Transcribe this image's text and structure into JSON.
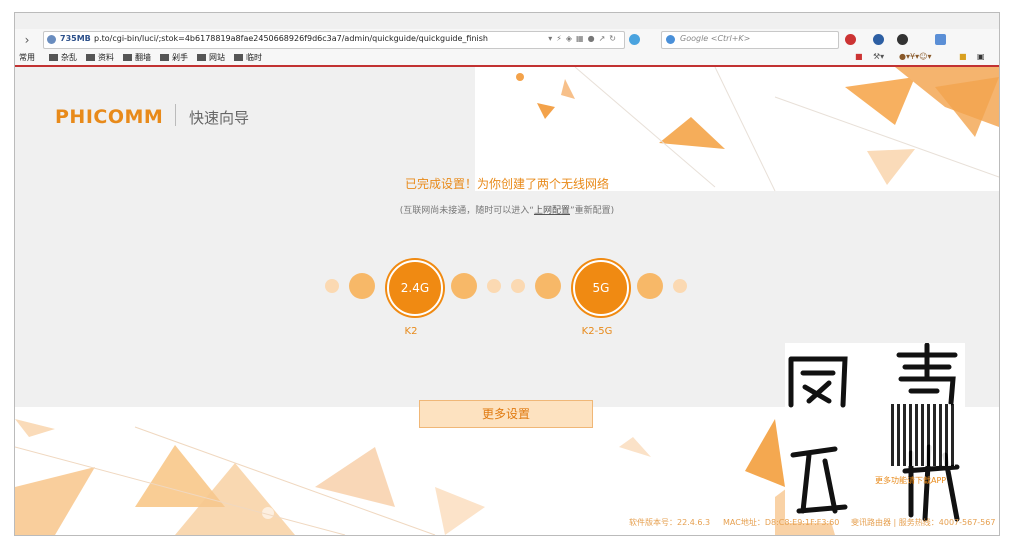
{
  "browser": {
    "memory": "735MB",
    "url": "p.to/cgi-bin/luci/;stok=4b6178819a8fae2450668926f9d6c3a7/admin/quickguide/quickguide_finish",
    "search_placeholder": "Google <Ctrl+K>",
    "bookmarks": [
      "常用",
      "杂乱",
      "资料",
      "翻墙",
      "剁手",
      "网站",
      "临时"
    ]
  },
  "header": {
    "brand": "PHICOMM",
    "title": "快速向导"
  },
  "main": {
    "headline": "已完成设置！为你创建了两个无线网络",
    "subline_prefix": "(互联网尚未接通，随时可以进入“",
    "subline_link": "上网配置",
    "subline_suffix": "”重新配置)",
    "networks": [
      {
        "band": "2.4G",
        "name": "K2"
      },
      {
        "band": "5G",
        "name": "K2-5G"
      }
    ],
    "more_button": "更多设置"
  },
  "watermark": {
    "qr_label": "更多功能请下载APP"
  },
  "footer": {
    "version": "软件版本号：22.4.6.3",
    "mac": "MAC地址：D8:C8:E9:1F:F3:60",
    "hotline": "斐讯路由器 | 服务热线：4007-567-567"
  },
  "colors": {
    "accent": "#f08a12",
    "accent_light": "#f7b868",
    "bookmark_border": "#c23232"
  }
}
